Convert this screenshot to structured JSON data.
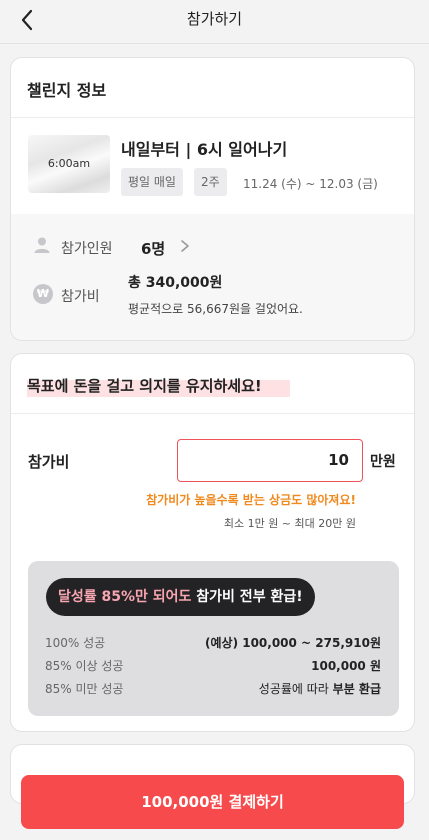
{
  "header": {
    "title": "참가하기",
    "back_icon": "chevron-left-icon"
  },
  "challenge_info": {
    "section_title": "챌린지 정보",
    "thumbnail_text": "6:00am",
    "name": "내일부터 | 6시 일어나기",
    "tags": [
      "평일 매일",
      "2주"
    ],
    "dates": "11.24 (수) ~ 12.03 (금)",
    "participants_label": "참가인원",
    "participants_value": "6명",
    "fee_label": "참가비",
    "fee_total": "총 340,000원",
    "fee_average": "평균적으로 56,667원을 걸었어요."
  },
  "stake": {
    "motto": "목표에 돈을 걸고 의지를 유지하세요!",
    "fee_label": "참가비",
    "amount": "10",
    "unit": "만원",
    "warning": "참가비가 높을수록 받는 상금도 많아져요!",
    "range": "최소 1만 원 ~ 최대 20만 원",
    "refund": {
      "banner_highlight": "달성률 85%만 되어도",
      "banner_rest": " 참가비 전부 환급!",
      "rows": [
        {
          "label": "100% 성공",
          "value": "(예상) 100,000 ~ 275,910원"
        },
        {
          "label": "85% 이상 성공",
          "value": "100,000 원"
        },
        {
          "label": "85% 미만 성공",
          "value_prefix": "성공률에 따라 ",
          "value_bold": "부분 환급"
        }
      ]
    }
  },
  "cta": {
    "label": "100,000원 결제하기"
  },
  "colors": {
    "accent": "#f64a4c",
    "warning": "#f08a1f",
    "highlight": "#fde1e3",
    "pill_bg": "#232325",
    "pill_pink": "#f7a5b0"
  }
}
